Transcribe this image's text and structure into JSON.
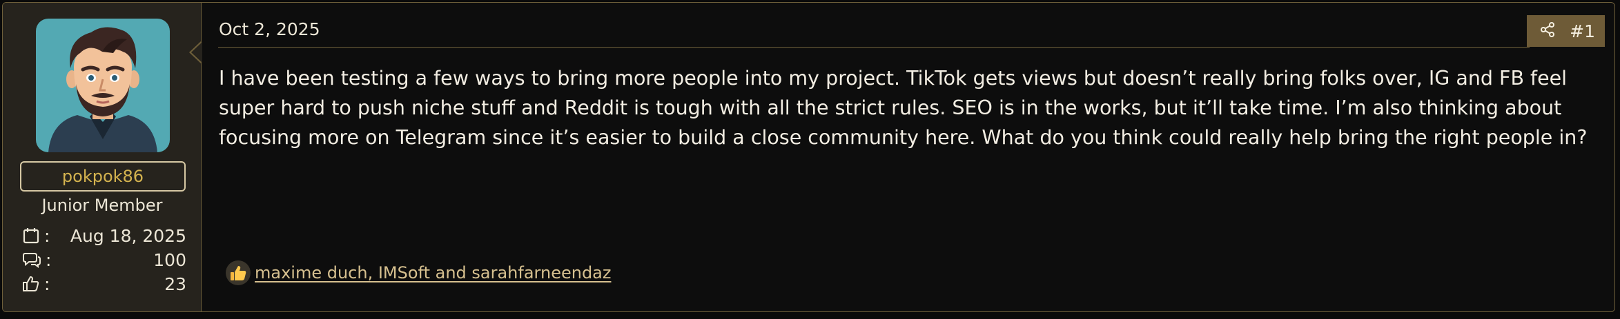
{
  "post": {
    "date": "Oct 2, 2025",
    "number": "#1",
    "share_icon": "share-icon",
    "body": "I have been testing a few ways to bring more people into my project. TikTok gets views but doesn’t really bring folks over, IG and FB feel super hard to push niche stuff and Reddit is tough with all the strict rules. SEO is in the works, but it’ll take time. I’m also thinking about focusing more on Telegram since it’s easier to build a close community here. What do you think could really help bring the right people in?",
    "reactions": {
      "icon": "thumbs-up-icon",
      "users_text": "maxime duch, IMSoft and sarahfarneendaz"
    }
  },
  "user": {
    "username": "pokpok86",
    "title": "Junior Member",
    "stats": [
      {
        "icon": "calendar-icon",
        "sep": ":",
        "value": "Aug 18, 2025"
      },
      {
        "icon": "messages-icon",
        "sep": ":",
        "value": "100"
      },
      {
        "icon": "thumbs-up-icon",
        "sep": ":",
        "value": "23"
      }
    ]
  },
  "colors": {
    "accent_gold": "#d4b34f",
    "border": "#6e5f3a",
    "panel": "#26231d",
    "avatar_bg": "#53a9b3"
  }
}
